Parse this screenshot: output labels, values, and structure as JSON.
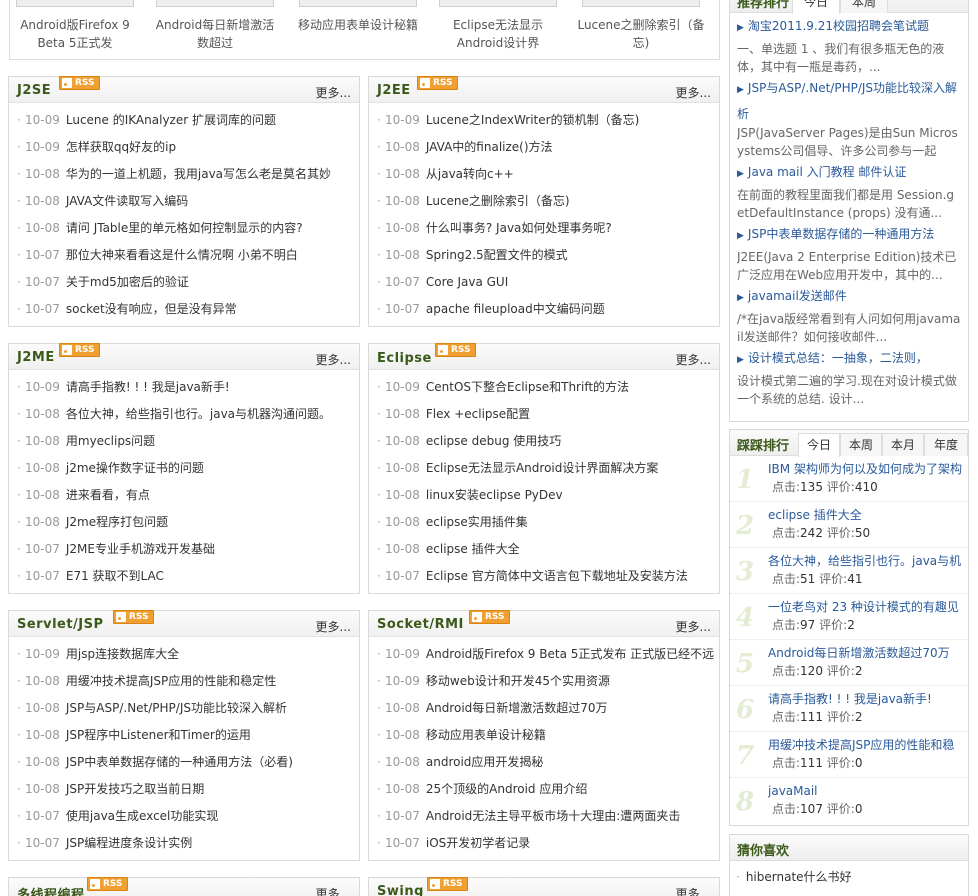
{
  "thumbs": [
    {
      "caption": "Android版Firefox 9 Beta 5正式发"
    },
    {
      "caption": "Android每日新增激活数超过"
    },
    {
      "caption": "移动应用表单设计秘籍"
    },
    {
      "caption": "Eclipse无法显示Android设计界"
    },
    {
      "caption": "Lucene之删除索引（备忘)"
    }
  ],
  "more_label": "更多...",
  "rss_label": "RSS",
  "panels": [
    {
      "title": "J2SE",
      "items": [
        {
          "date": "10-09",
          "text": "Lucene 的IKAnalyzer 扩展词库的问题"
        },
        {
          "date": "10-09",
          "text": "怎样获取qq好友的ip"
        },
        {
          "date": "10-08",
          "text": "华为的一道上机题，我用java写怎么老是莫名其妙"
        },
        {
          "date": "10-08",
          "text": "JAVA文件读取写入编码"
        },
        {
          "date": "10-08",
          "text": "请问 JTable里的单元格如何控制显示的内容?"
        },
        {
          "date": "10-07",
          "text": "那位大神来看看这是什么情况啊 小弟不明白"
        },
        {
          "date": "10-07",
          "text": "关于md5加密后的验证"
        },
        {
          "date": "10-07",
          "text": "socket没有响应，但是没有异常"
        }
      ]
    },
    {
      "title": "J2EE",
      "items": [
        {
          "date": "10-09",
          "text": "Lucene之IndexWriter的锁机制（备忘)"
        },
        {
          "date": "10-08",
          "text": "JAVA中的finalize()方法"
        },
        {
          "date": "10-08",
          "text": "从java转向c++"
        },
        {
          "date": "10-08",
          "text": "Lucene之删除索引（备忘)"
        },
        {
          "date": "10-08",
          "text": "什么叫事务? Java如何处理事务呢?"
        },
        {
          "date": "10-08",
          "text": "Spring2.5配置文件的模式"
        },
        {
          "date": "10-07",
          "text": "Core Java GUI"
        },
        {
          "date": "10-07",
          "text": "apache fileupload中文编码问题"
        }
      ]
    },
    {
      "title": "J2ME",
      "items": [
        {
          "date": "10-09",
          "text": "请高手指教! ! ! 我是java新手!"
        },
        {
          "date": "10-08",
          "text": "各位大神，给些指引也行。java与机器沟通问题。"
        },
        {
          "date": "10-08",
          "text": "用myeclips问题"
        },
        {
          "date": "10-08",
          "text": "j2me操作数字证书的问题"
        },
        {
          "date": "10-08",
          "text": "进来看看，有点"
        },
        {
          "date": "10-08",
          "text": "J2me程序打包问题"
        },
        {
          "date": "10-07",
          "text": "J2ME专业手机游戏开发基础"
        },
        {
          "date": "10-07",
          "text": "E71 获取不到LAC"
        }
      ]
    },
    {
      "title": "Eclipse",
      "items": [
        {
          "date": "10-09",
          "text": "CentOS下整合Eclipse和Thrift的方法"
        },
        {
          "date": "10-08",
          "text": "Flex +eclipse配置"
        },
        {
          "date": "10-08",
          "text": "eclipse debug 使用技巧"
        },
        {
          "date": "10-08",
          "text": "Eclipse无法显示Android设计界面解决方案"
        },
        {
          "date": "10-08",
          "text": "linux安装eclipse PyDev"
        },
        {
          "date": "10-08",
          "text": "eclipse实用插件集"
        },
        {
          "date": "10-08",
          "text": "eclipse 插件大全"
        },
        {
          "date": "10-07",
          "text": "Eclipse 官方简体中文语言包下载地址及安装方法"
        }
      ]
    },
    {
      "title": "Servlet/JSP",
      "items": [
        {
          "date": "10-09",
          "text": "用jsp连接数据库大全"
        },
        {
          "date": "10-08",
          "text": "用缓冲技术提高JSP应用的性能和稳定性"
        },
        {
          "date": "10-08",
          "text": "JSP与ASP/.Net/PHP/JS功能比较深入解析"
        },
        {
          "date": "10-08",
          "text": "JSP程序中Listener和Timer的运用"
        },
        {
          "date": "10-08",
          "text": "JSP中表单数据存储的一种通用方法（必看)"
        },
        {
          "date": "10-08",
          "text": "JSP开发技巧之取当前日期"
        },
        {
          "date": "10-07",
          "text": "使用java生成excel功能实现"
        },
        {
          "date": "10-07",
          "text": "JSP编程进度条设计实例"
        }
      ]
    },
    {
      "title": "Socket/RMI",
      "items": [
        {
          "date": "10-09",
          "text": "Android版Firefox 9 Beta 5正式发布 正式版已经不远"
        },
        {
          "date": "10-09",
          "text": "移动web设计和开发45个实用资源"
        },
        {
          "date": "10-08",
          "text": "Android每日新增激活数超过70万"
        },
        {
          "date": "10-08",
          "text": "移动应用表单设计秘籍"
        },
        {
          "date": "10-08",
          "text": "android应用开发揭秘"
        },
        {
          "date": "10-08",
          "text": "25个顶级的Android 应用介绍"
        },
        {
          "date": "10-07",
          "text": "Android无法主导平板市场十大理由:遭两面夹击"
        },
        {
          "date": "10-07",
          "text": "iOS开发初学者记录"
        }
      ]
    },
    {
      "title": "多线程编程",
      "items": []
    },
    {
      "title": "Swing",
      "items": []
    }
  ],
  "recommend": {
    "title": "推荐排行",
    "tabs": [
      "今日",
      "本周"
    ],
    "items": [
      {
        "title": "淘宝2011.9.21校园招聘会笔试题",
        "desc": "一、单选题 1 、我们有很多瓶无色的液体，其中有一瓶是毒药，..."
      },
      {
        "title": "JSP与ASP/.Net/PHP/JS功能比较深入解析",
        "desc": "JSP(JavaServer Pages)是由Sun Microsystems公司倡导、许多公司参与一起"
      },
      {
        "title": "Java mail 入门教程 邮件认证",
        "desc": "在前面的教程里面我们都是用 Session.getDefaultInstance (props) 没有通..."
      },
      {
        "title": "JSP中表单数据存储的一种通用方法",
        "desc": "J2EE(Java 2 Enterprise Edition)技术已广泛应用在Web应用开发中，其中的..."
      },
      {
        "title": "javamail发送邮件",
        "desc": "/*在java版经常看到有人问如何用javamail发送邮件？如何接收邮件..."
      },
      {
        "title": "设计模式总结：一抽象，二法则，",
        "desc": "设计模式第二遍的学习.现在对设计模式做一个系统的总结. 设计..."
      }
    ]
  },
  "top": {
    "title": "踩踩排行",
    "tabs": [
      "今日",
      "本周",
      "本月",
      "年度"
    ],
    "clicks_label": "点击:",
    "rating_label": "评价:",
    "items": [
      {
        "num": "1",
        "title": "IBM 架构师为何以及如何成为了架构",
        "clicks": "135",
        "rating": "410"
      },
      {
        "num": "2",
        "title": "eclipse 插件大全",
        "clicks": "242",
        "rating": "50"
      },
      {
        "num": "3",
        "title": "各位大神，给些指引也行。java与机",
        "clicks": "51",
        "rating": "41"
      },
      {
        "num": "4",
        "title": "一位老鸟对 23 种设计模式的有趣见",
        "clicks": "97",
        "rating": "2"
      },
      {
        "num": "5",
        "title": "Android每日新增激活数超过70万",
        "clicks": "120",
        "rating": "2"
      },
      {
        "num": "6",
        "title": "请高手指教! ! ! 我是java新手!",
        "clicks": "111",
        "rating": "2"
      },
      {
        "num": "7",
        "title": "用缓冲技术提高JSP应用的性能和稳",
        "clicks": "111",
        "rating": "0"
      },
      {
        "num": "8",
        "title": "javaMail",
        "clicks": "107",
        "rating": "0"
      }
    ]
  },
  "guess": {
    "title": "猜你喜欢",
    "items": [
      "hibernate什么书好"
    ]
  }
}
